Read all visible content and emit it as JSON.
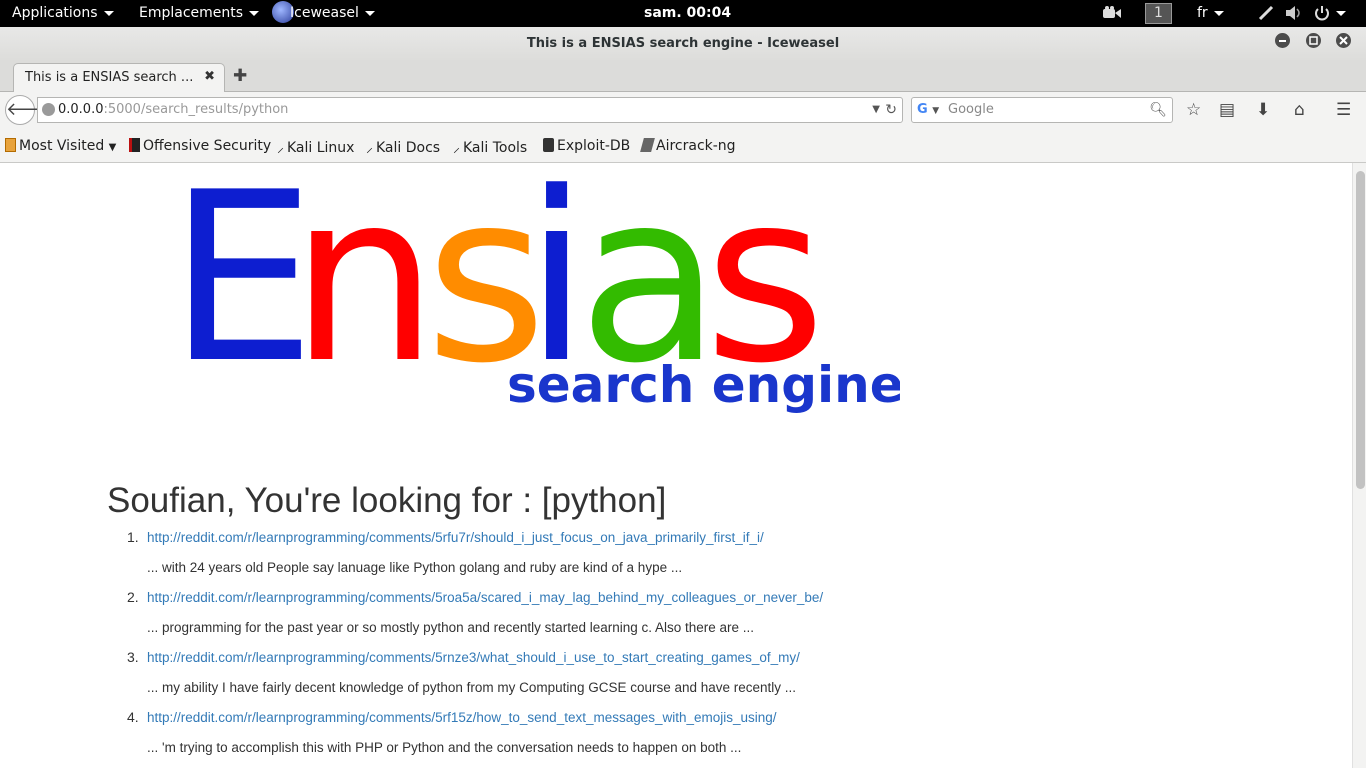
{
  "topbar": {
    "applications": "Applications",
    "places": "Emplacements",
    "app_name": "Iceweasel",
    "clock": "sam. 00:04",
    "workspace": "1",
    "language": "fr"
  },
  "window": {
    "title": "This is a ENSIAS search engine - Iceweasel"
  },
  "tab": {
    "label": "This is a ENSIAS search ..."
  },
  "urlbar": {
    "host": "0.0.0.0",
    "path": ":5000/search_results/python"
  },
  "searchbar": {
    "placeholder": "Google"
  },
  "bookmarks": [
    {
      "label": "Most Visited",
      "icon": "most-visited-icon"
    },
    {
      "label": "Offensive Security",
      "icon": "offsec-icon"
    },
    {
      "label": "Kali Linux",
      "icon": "kali-dragon-icon"
    },
    {
      "label": "Kali Docs",
      "icon": "kali-dragon-icon"
    },
    {
      "label": "Kali Tools",
      "icon": "kali-dragon-icon"
    },
    {
      "label": "Exploit-DB",
      "icon": "exploitdb-icon"
    },
    {
      "label": "Aircrack-ng",
      "icon": "aircrack-icon"
    }
  ],
  "logo": {
    "letters": [
      "E",
      "n",
      "s",
      "i",
      "a",
      "s"
    ],
    "letter_colors": [
      "#0d1ed0",
      "#ff0000",
      "#ff8c00",
      "#0d1ed0",
      "#33bb00",
      "#ff0000"
    ],
    "subtitle": "search engine",
    "subtitle_color": "#1a36cc"
  },
  "page": {
    "heading": "Soufian, You're looking for : [python]",
    "results": [
      {
        "num": "1.",
        "url": "http://reddit.com/r/learnprogramming/comments/5rfu7r/should_i_just_focus_on_java_primarily_first_if_i/",
        "snippet": "... with 24 years old People say lanuage like Python golang and ruby are kind of a hype ..."
      },
      {
        "num": "2.",
        "url": "http://reddit.com/r/learnprogramming/comments/5roa5a/scared_i_may_lag_behind_my_colleagues_or_never_be/",
        "snippet": "... programming for the past year or so mostly python and recently started learning c. Also there are ..."
      },
      {
        "num": "3.",
        "url": "http://reddit.com/r/learnprogramming/comments/5rnze3/what_should_i_use_to_start_creating_games_of_my/",
        "snippet": "... my ability I have fairly decent knowledge of python from my Computing GCSE course and have recently ..."
      },
      {
        "num": "4.",
        "url": "http://reddit.com/r/learnprogramming/comments/5rf15z/how_to_send_text_messages_with_emojis_using/",
        "snippet": "... 'm trying to accomplish this with PHP or Python and the conversation needs to happen on both ..."
      }
    ]
  }
}
